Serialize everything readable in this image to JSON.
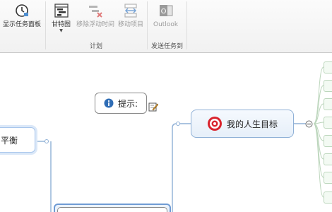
{
  "ribbon": {
    "task_pane_label": "显示任务面板",
    "gantt_label": "甘特图",
    "remove_time_label": "移除浮动时间",
    "move_item_label": "移动项目",
    "outlook_label": "Outlook",
    "group_plan_label": "计划",
    "group_send_label": "发送任务到"
  },
  "canvas": {
    "tip_label": "提示:",
    "goal_label": "我的人生目标",
    "balance_label": "平衡",
    "collapse_symbol": "−"
  },
  "colors": {
    "accent_blue": "#8fb0d6",
    "target_red": "#d9232d",
    "leaf_green": "#bcd6bc"
  },
  "icons": [
    "clock-icon",
    "gantt-chart-icon",
    "remove-slack-icon",
    "move-item-icon",
    "outlook-icon",
    "info-icon",
    "note-icon",
    "target-icon"
  ]
}
